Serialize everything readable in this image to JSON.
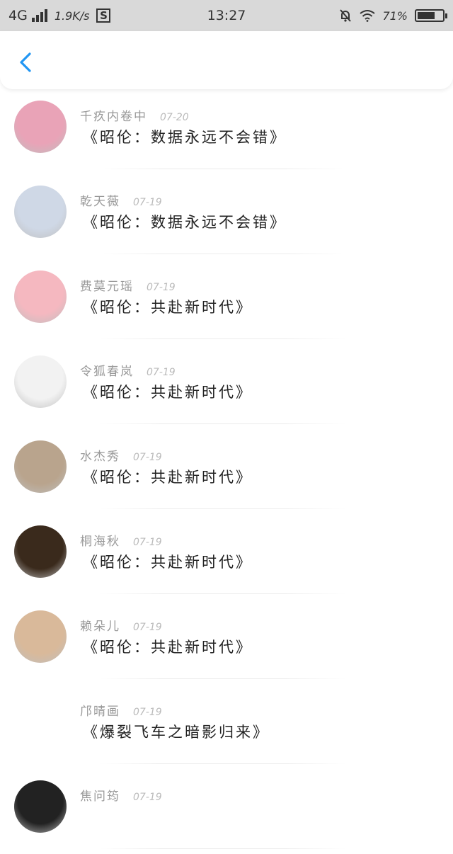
{
  "status_bar": {
    "network": "4G",
    "speed": "1.9K/s",
    "sim_badge": "S",
    "time": "13:27",
    "battery": "71%",
    "battery_level": 0.71
  },
  "nav": {
    "back_icon": "chevron-left-icon",
    "accent": "#2196f3"
  },
  "comments": [
    {
      "user": "千疚内卷中",
      "date": "07-20",
      "message": "《昭伦：数据永远不会错》",
      "avatar_color": "#e9a3b7"
    },
    {
      "user": "乾天薇",
      "date": "07-19",
      "message": "《昭伦：数据永远不会错》",
      "avatar_color": "#cfd8e6"
    },
    {
      "user": "费莫元瑶",
      "date": "07-19",
      "message": "《昭伦：共赴新时代》",
      "avatar_color": "#f5b8c0"
    },
    {
      "user": "令狐春岚",
      "date": "07-19",
      "message": "《昭伦：共赴新时代》",
      "avatar_color": "#f2f2f2"
    },
    {
      "user": "水杰秀",
      "date": "07-19",
      "message": "《昭伦：共赴新时代》",
      "avatar_color": "#b9a48d"
    },
    {
      "user": "桐海秋",
      "date": "07-19",
      "message": "《昭伦：共赴新时代》",
      "avatar_color": "#3a2a1c"
    },
    {
      "user": "赖朵儿",
      "date": "07-19",
      "message": "《昭伦：共赴新时代》",
      "avatar_color": "#d9b99a"
    },
    {
      "user": "邝晴画",
      "date": "07-19",
      "message": "《爆裂飞车之暗影归来》",
      "avatar_color": "#ffffff"
    },
    {
      "user": "焦问筠",
      "date": "07-19",
      "message": "",
      "avatar_color": "#222222"
    }
  ]
}
